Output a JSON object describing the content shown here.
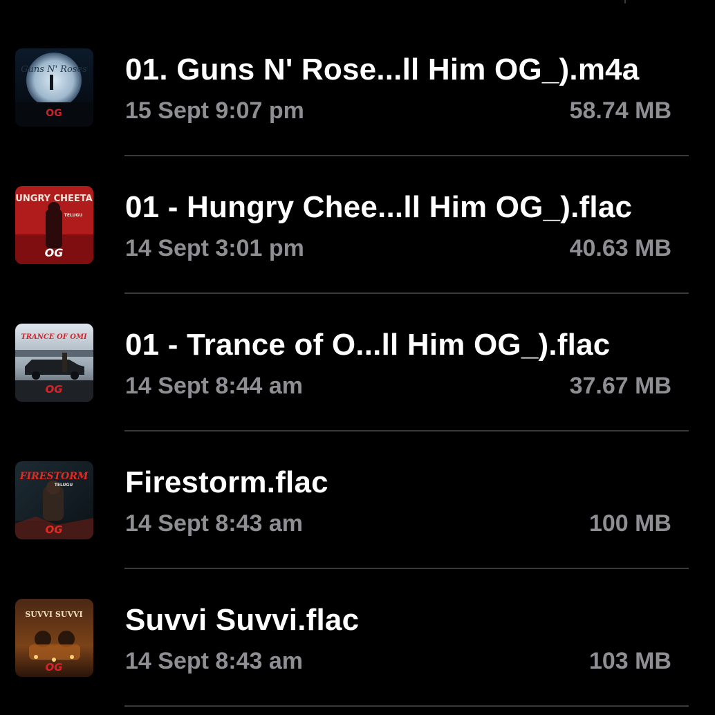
{
  "colors": {
    "background": "#000000",
    "title_text": "#ffffff",
    "meta_text": "#8e8e93",
    "divider": "#3a3a3c"
  },
  "files": [
    {
      "title": "01. Guns N' Rose...ll Him OG_).m4a",
      "date": "15 Sept 9:07 pm",
      "size": "58.74 MB",
      "artwork_label": "Guns N' Roses",
      "artwork_badge": "OG"
    },
    {
      "title": "01 - Hungry Chee...ll Him OG_).flac",
      "date": "14 Sept 3:01 pm",
      "size": "40.63 MB",
      "artwork_label": "HUNGRY CHEETAH",
      "artwork_sub": "TELUGU",
      "artwork_badge": "OG"
    },
    {
      "title": "01 - Trance of O...ll Him OG_).flac",
      "date": "14 Sept 8:44 am",
      "size": "37.67 MB",
      "artwork_label": "TRANCE OF OMI",
      "artwork_badge": "OG"
    },
    {
      "title": "Firestorm.flac",
      "date": "14 Sept 8:43 am",
      "size": "100 MB",
      "artwork_label": "FIRESTORM",
      "artwork_sub": "TELUGU",
      "artwork_badge": "OG"
    },
    {
      "title": "Suvvi Suvvi.flac",
      "date": "14 Sept 8:43 am",
      "size": "103 MB",
      "artwork_label": "SUVVI SUVVI",
      "artwork_badge": "OG"
    }
  ]
}
